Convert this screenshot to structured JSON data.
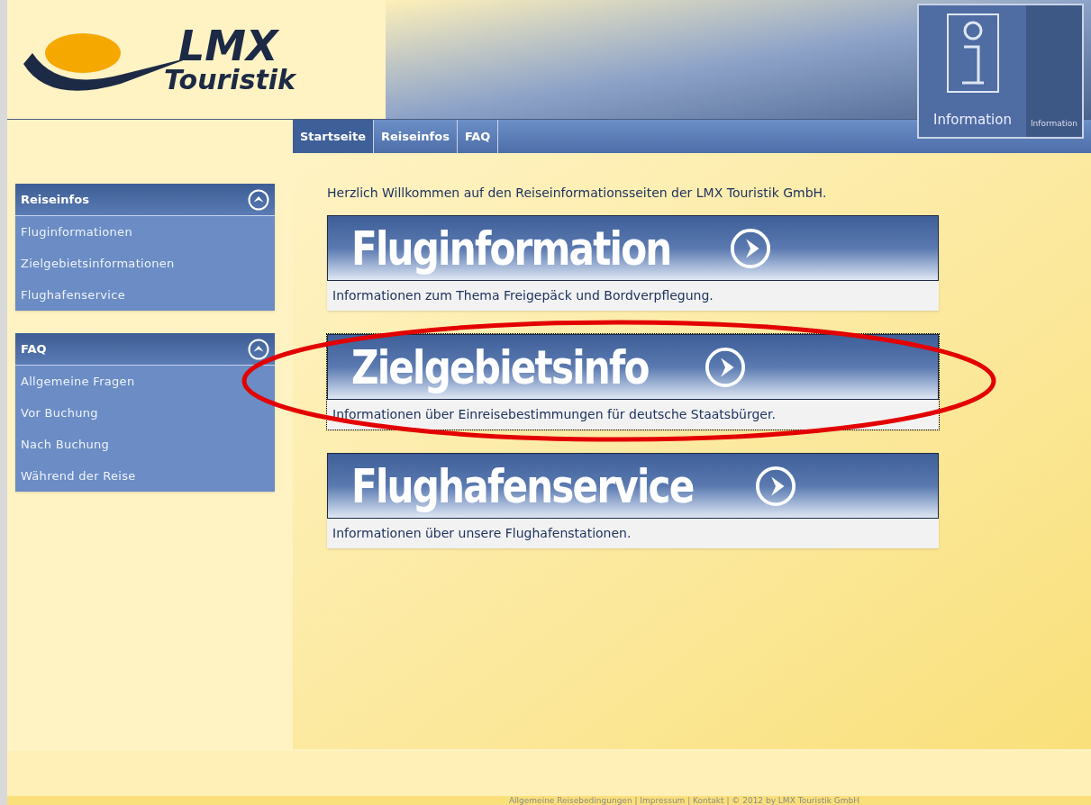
{
  "logo": {
    "line_1": "LMX",
    "line_2": "Touristik"
  },
  "header_sign": {
    "label": "Information",
    "side_label": "Information"
  },
  "nav": [
    {
      "label": "Startseite",
      "selected": true
    },
    {
      "label": "Reiseinfos",
      "selected": false
    },
    {
      "label": "FAQ",
      "selected": false
    }
  ],
  "sidebar": [
    {
      "title": "Reiseinfos",
      "expanded": true,
      "items": [
        "Fluginformationen",
        "Zielgebietsinformationen",
        "Flughafenservice"
      ]
    },
    {
      "title": "FAQ",
      "expanded": true,
      "items": [
        "Allgemeine Fragen",
        "Vor Buchung",
        "Nach Buchung",
        "Während der Reise"
      ]
    }
  ],
  "welcome": "Herzlich Willkommen auf den Reiseinformationsseiten der LMX Touristik GmbH.",
  "cards": [
    {
      "title": "Fluginformation",
      "description": "Informationen zum Thema Freigepäck und Bordverpflegung.",
      "selected": false
    },
    {
      "title": "Zielgebietsinfo",
      "description": "Informationen über Einreisebestimmungen für deutsche Staatsbürger.",
      "selected": true
    },
    {
      "title": "Flughafenservice",
      "description": "Informationen über unsere Flughafenstationen.",
      "selected": false
    }
  ],
  "footer": "Allgemeine Reisebedingungen | Impressum | Kontakt | © 2012 by LMX Touristik GmbH"
}
